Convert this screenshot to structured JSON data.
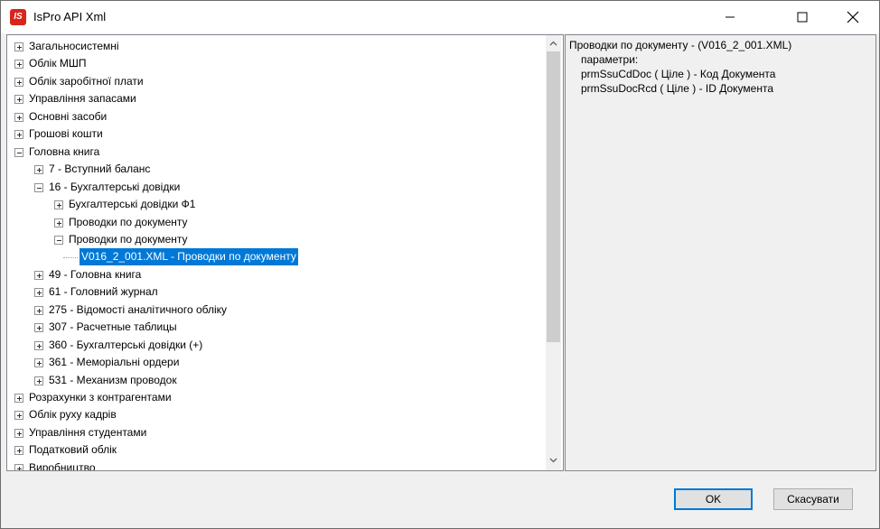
{
  "window": {
    "title": "IsPro API Xml",
    "icon": "ispro-logo-icon",
    "logo_text": "IS"
  },
  "tree": {
    "items": [
      {
        "label": "Загальносистемні",
        "level": 0,
        "state": "collapsed"
      },
      {
        "label": "Облік МШП",
        "level": 0,
        "state": "collapsed"
      },
      {
        "label": "Облік заробітної плати",
        "level": 0,
        "state": "collapsed"
      },
      {
        "label": "Управління запасами",
        "level": 0,
        "state": "collapsed"
      },
      {
        "label": "Основні засоби",
        "level": 0,
        "state": "collapsed"
      },
      {
        "label": "Грошові кошти",
        "level": 0,
        "state": "collapsed"
      },
      {
        "label": "Головна книга",
        "level": 0,
        "state": "expanded"
      },
      {
        "label": "7 - Вступний баланс",
        "level": 1,
        "state": "collapsed"
      },
      {
        "label": "16 - Бухгалтерські довідки",
        "level": 1,
        "state": "expanded"
      },
      {
        "label": "Бухгалтерські довідки Ф1",
        "level": 2,
        "state": "collapsed"
      },
      {
        "label": "Проводки по документу",
        "level": 2,
        "state": "collapsed"
      },
      {
        "label": "Проводки по документу",
        "level": 2,
        "state": "expanded"
      },
      {
        "label": "V016_2_001.XML - Проводки по документу",
        "level": 3,
        "state": "leaf",
        "selected": true
      },
      {
        "label": "49 - Головна книга",
        "level": 1,
        "state": "collapsed"
      },
      {
        "label": "61 - Головний журнал",
        "level": 1,
        "state": "collapsed"
      },
      {
        "label": "275 - Відомості аналітичного обліку",
        "level": 1,
        "state": "collapsed"
      },
      {
        "label": "307 - Расчетные таблицы",
        "level": 1,
        "state": "collapsed"
      },
      {
        "label": "360 - Бухгалтерські довідки (+)",
        "level": 1,
        "state": "collapsed"
      },
      {
        "label": "361 - Меморіальні ордери",
        "level": 1,
        "state": "collapsed"
      },
      {
        "label": "531 - Механизм проводок",
        "level": 1,
        "state": "collapsed"
      },
      {
        "label": "Розрахунки з контрагентами",
        "level": 0,
        "state": "collapsed"
      },
      {
        "label": "Облік руху кадрів",
        "level": 0,
        "state": "collapsed"
      },
      {
        "label": "Управління студентами",
        "level": 0,
        "state": "collapsed"
      },
      {
        "label": "Податковий облік",
        "level": 0,
        "state": "collapsed"
      },
      {
        "label": "Виробництво",
        "level": 0,
        "state": "collapsed"
      }
    ]
  },
  "description": {
    "lines": [
      "Проводки по документу - (V016_2_001.XML)",
      "параметри:",
      "prmSsuCdDoc ( Ціле ) -  Код Документа",
      "prmSsuDocRcd ( Ціле ) -  ID Документа"
    ]
  },
  "buttons": {
    "ok": "OK",
    "cancel": "Скасувати"
  },
  "colors": {
    "selection": "#0078d7",
    "logo": "#d9251c"
  }
}
